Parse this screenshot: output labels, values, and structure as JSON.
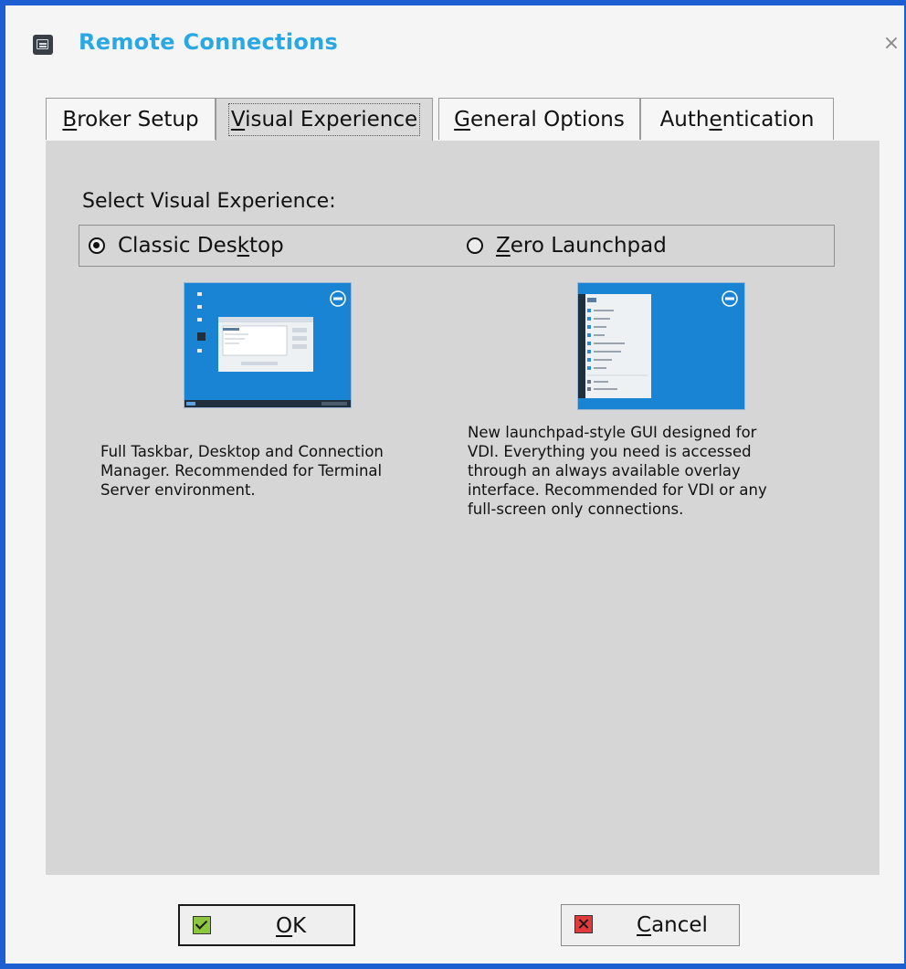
{
  "window": {
    "title": "Remote Connections",
    "accent_color": "#1d5fd0",
    "title_color": "#2aa7e5"
  },
  "tabs": [
    {
      "label": "Broker Setup",
      "mnemonic_index": 0,
      "active": false
    },
    {
      "label": "Visual Experience",
      "mnemonic_index": 0,
      "active": true
    },
    {
      "label": "General Options",
      "mnemonic_index": 0,
      "active": false
    },
    {
      "label": "Authentication",
      "mnemonic_index": 4,
      "active": false
    }
  ],
  "visual_experience": {
    "section_label": "Select Visual Experience:",
    "options": [
      {
        "label_parts": [
          "Classic Des",
          "k",
          "top"
        ],
        "selected": true,
        "description": "Full Taskbar, Desktop and Connection\nManager. Recommended for Terminal\nServer environment."
      },
      {
        "label_parts": [
          "",
          "Z",
          "ero Launchpad"
        ],
        "selected": false,
        "description": "New launchpad-style GUI designed for\nVDI. Everything you need is accessed\nthrough an always available overlay\ninterface. Recommended for VDI or any\nfull-screen only connections."
      }
    ]
  },
  "buttons": {
    "ok": {
      "label_parts": [
        "",
        "O",
        "K"
      ]
    },
    "cancel": {
      "label_parts": [
        "",
        "C",
        "ancel"
      ]
    }
  }
}
